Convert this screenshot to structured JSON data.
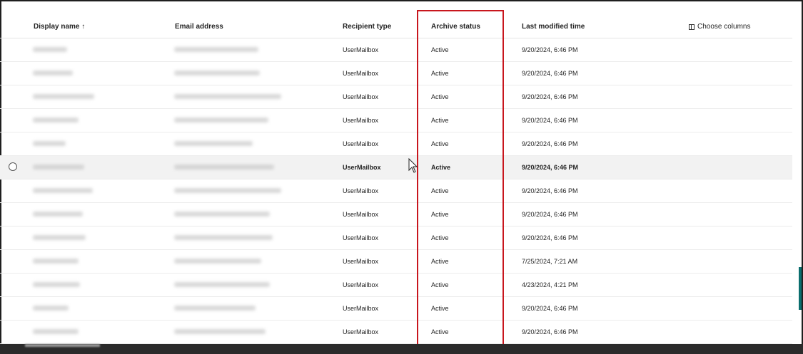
{
  "columns": {
    "display_name": "Display name ↑",
    "email": "Email address",
    "recipient_type": "Recipient type",
    "archive_status": "Archive status",
    "last_modified": "Last modified time",
    "choose_columns": "Choose columns"
  },
  "rows": [
    {
      "recipient_type": "UserMailbox",
      "archive_status": "Active",
      "last_modified": "9/20/2024, 6:46 PM"
    },
    {
      "recipient_type": "UserMailbox",
      "archive_status": "Active",
      "last_modified": "9/20/2024, 6:46 PM"
    },
    {
      "recipient_type": "UserMailbox",
      "archive_status": "Active",
      "last_modified": "9/20/2024, 6:46 PM"
    },
    {
      "recipient_type": "UserMailbox",
      "archive_status": "Active",
      "last_modified": "9/20/2024, 6:46 PM"
    },
    {
      "recipient_type": "UserMailbox",
      "archive_status": "Active",
      "last_modified": "9/20/2024, 6:46 PM"
    },
    {
      "recipient_type": "UserMailbox",
      "archive_status": "Active",
      "last_modified": "9/20/2024, 6:46 PM"
    },
    {
      "recipient_type": "UserMailbox",
      "archive_status": "Active",
      "last_modified": "9/20/2024, 6:46 PM"
    },
    {
      "recipient_type": "UserMailbox",
      "archive_status": "Active",
      "last_modified": "9/20/2024, 6:46 PM"
    },
    {
      "recipient_type": "UserMailbox",
      "archive_status": "Active",
      "last_modified": "9/20/2024, 6:46 PM"
    },
    {
      "recipient_type": "UserMailbox",
      "archive_status": "Active",
      "last_modified": "7/25/2024, 7:21 AM"
    },
    {
      "recipient_type": "UserMailbox",
      "archive_status": "Active",
      "last_modified": "4/23/2024, 4:21 PM"
    },
    {
      "recipient_type": "UserMailbox",
      "archive_status": "Active",
      "last_modified": "9/20/2024, 6:46 PM"
    },
    {
      "recipient_type": "UserMailbox",
      "archive_status": "Active",
      "last_modified": "9/20/2024, 6:46 PM"
    }
  ],
  "icons": {
    "choose_columns": "table-columns-icon",
    "row_select": "radio-circle-icon",
    "cursor": "mouse-pointer-icon"
  },
  "colors": {
    "highlight_box": "#c8161d",
    "selected_row": "#f2f2f2",
    "scroll_thumb": "#0a6e6e"
  }
}
